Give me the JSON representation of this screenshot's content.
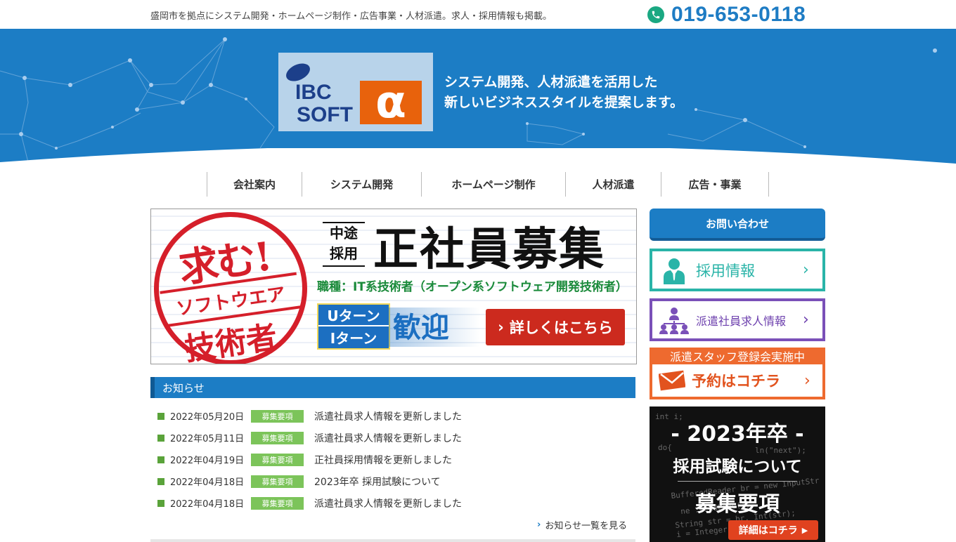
{
  "topbar": {
    "tagline": "盛岡市を拠点にシステム開発・ホームページ制作・広告事業・人材派遣。求人・採用情報も掲載。",
    "phone": "019-653-0118"
  },
  "hero": {
    "logo_text_1": "IBC",
    "logo_text_2": "SOFT",
    "logo_symbol": "α",
    "line1": "システム開発、人材派遣を活用した",
    "line2": "新しいビジネススタイルを提案します。"
  },
  "nav": {
    "items": [
      {
        "label": "会社案内"
      },
      {
        "label": "システム開発"
      },
      {
        "label": "ホームページ制作"
      },
      {
        "label": "人材派遣"
      },
      {
        "label": "広告・事業"
      }
    ]
  },
  "banner": {
    "stamp_main": "求む!",
    "stamp_band": "ソフトウエア",
    "stamp_sub": "技術者",
    "tag_line1": "中途",
    "tag_line2": "採用",
    "title": "正社員募集",
    "job": "職種：IT系技術者（オープン系ソフトウェア開発技術者）",
    "uturn": "Uターン",
    "iturn": "Iターン",
    "welcome": "歓迎",
    "cta": "詳しくはこちら"
  },
  "news": {
    "heading": "お知らせ",
    "items": [
      {
        "date": "2022年05月20日",
        "badge": "募集要項",
        "title": "派遣社員求人情報を更新しました"
      },
      {
        "date": "2022年05月11日",
        "badge": "募集要項",
        "title": "派遣社員求人情報を更新しました"
      },
      {
        "date": "2022年04月19日",
        "badge": "募集要項",
        "title": "正社員採用情報を更新しました"
      },
      {
        "date": "2022年04月18日",
        "badge": "募集要項",
        "title": "2023年卒 採用試験について"
      },
      {
        "date": "2022年04月18日",
        "badge": "募集要項",
        "title": "派遣社員求人情報を更新しました"
      }
    ],
    "more": "お知らせ一覧を見る"
  },
  "sidebar": {
    "contact": "お問い合わせ",
    "recruit": "採用情報",
    "haken": "派遣社員求人情報",
    "staff_top": "派遣スタッフ登録会実施中",
    "staff_cta": "予約はコチラ",
    "exam_year": "- 2023年卒 -",
    "exam_sub": "採用試験について",
    "exam_main": "募集要項",
    "exam_btn": "詳細はコチラ"
  },
  "colors": {
    "brand_blue": "#1c7dc5",
    "teal": "#2ab4a8",
    "purple": "#7a50b8",
    "orange": "#ee6a2f",
    "red": "#cc2a1e",
    "news_green": "#7cc45a"
  }
}
